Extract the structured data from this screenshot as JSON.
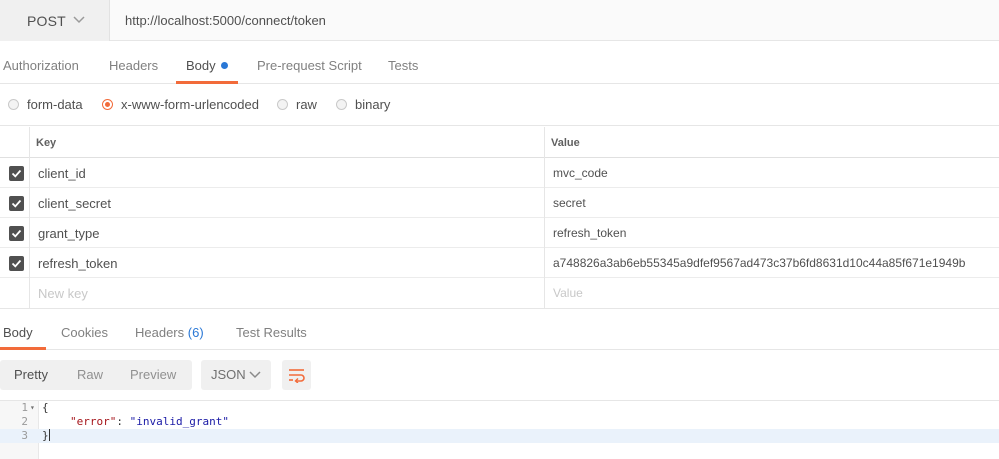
{
  "request": {
    "method": "POST",
    "url": "http://localhost:5000/connect/token"
  },
  "request_tabs": [
    {
      "label": "Authorization"
    },
    {
      "label": "Headers"
    },
    {
      "label": "Body",
      "active": true,
      "has_dot": true
    },
    {
      "label": "Pre-request Script"
    },
    {
      "label": "Tests"
    }
  ],
  "body_types": [
    {
      "label": "form-data",
      "checked": false
    },
    {
      "label": "x-www-form-urlencoded",
      "checked": true
    },
    {
      "label": "raw",
      "checked": false
    },
    {
      "label": "binary",
      "checked": false
    }
  ],
  "params_table": {
    "headers": {
      "key": "Key",
      "value": "Value"
    },
    "rows": [
      {
        "key": "client_id",
        "value": "mvc_code",
        "checked": true
      },
      {
        "key": "client_secret",
        "value": "secret",
        "checked": true
      },
      {
        "key": "grant_type",
        "value": "refresh_token",
        "checked": true
      },
      {
        "key": "refresh_token",
        "value": "a748826a3ab6eb55345a9dfef9567ad473c37b6fd8631d10c44a85f671e1949b",
        "checked": true
      }
    ],
    "new_row": {
      "key_placeholder": "New key",
      "value_placeholder": "Value"
    }
  },
  "response_tabs": [
    {
      "label": "Body",
      "active": true
    },
    {
      "label": "Cookies"
    },
    {
      "label": "Headers",
      "count": "(6)"
    },
    {
      "label": "Test Results"
    }
  ],
  "response_toolbar": {
    "views": [
      "Pretty",
      "Raw",
      "Preview"
    ],
    "active_view": "Pretty",
    "format": "JSON"
  },
  "response_body": {
    "lines": [
      {
        "number": "1",
        "text": "{"
      },
      {
        "number": "2",
        "key": "\"error\"",
        "sep": ": ",
        "value": "\"invalid_grant\""
      },
      {
        "number": "3",
        "text": "}"
      }
    ]
  },
  "colors": {
    "accent": "#f26b3a",
    "link_blue": "#2a78d6"
  }
}
